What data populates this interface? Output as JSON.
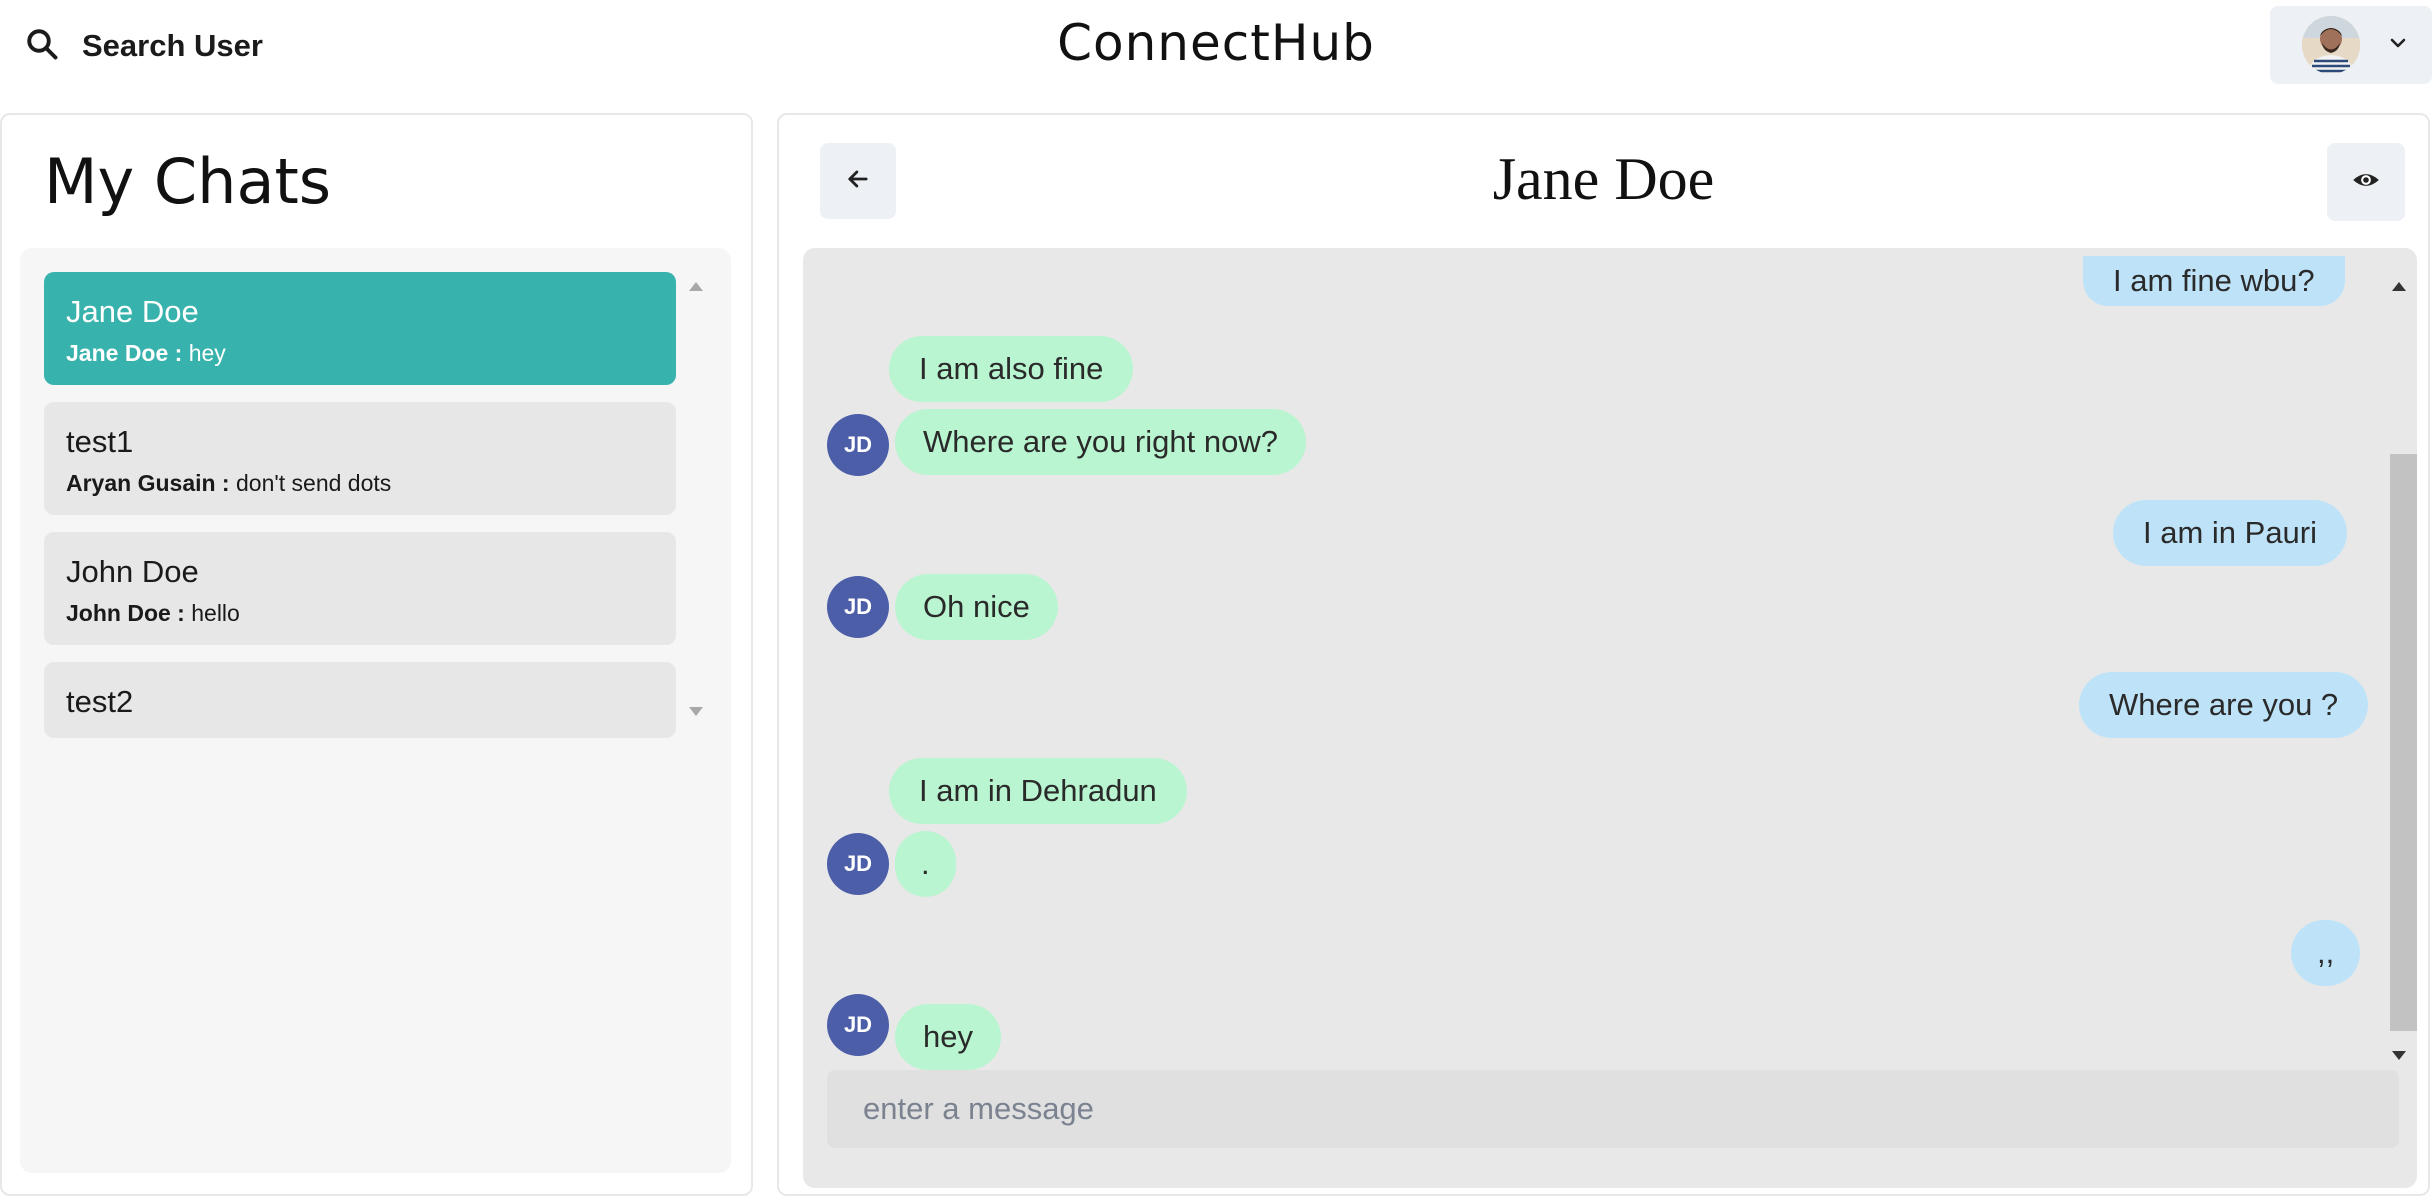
{
  "header": {
    "search_label": "Search User",
    "app_title": "ConnectHub"
  },
  "chats": {
    "title": "My Chats",
    "items": [
      {
        "name": "Jane Doe",
        "sender": "Jane Doe :",
        "message": "hey",
        "active": true
      },
      {
        "name": "test1",
        "sender": "Aryan Gusain :",
        "message": "don't send dots",
        "active": false
      },
      {
        "name": "John Doe",
        "sender": "John Doe :",
        "message": "hello",
        "active": false
      },
      {
        "name": "test2",
        "sender": "",
        "message": "",
        "active": false
      }
    ]
  },
  "conversation": {
    "title": "Jane Doe",
    "avatar_initials": "JD",
    "messages": [
      {
        "text": "I am fine wbu?",
        "from": "me"
      },
      {
        "text": "I am also fine",
        "from": "them"
      },
      {
        "text": "Where are you right now?",
        "from": "them"
      },
      {
        "text": "I am in Pauri",
        "from": "me"
      },
      {
        "text": "Oh nice",
        "from": "them"
      },
      {
        "text": "Where are you ?",
        "from": "me"
      },
      {
        "text": "I am in Dehradun",
        "from": "them"
      },
      {
        "text": ".",
        "from": "them"
      },
      {
        "text": ",,",
        "from": "me"
      },
      {
        "text": "hey",
        "from": "them"
      }
    ],
    "input_placeholder": "enter a message"
  },
  "icons": {
    "search": "search-icon",
    "chevron": "chevron-down-icon",
    "back": "arrow-left-icon",
    "view": "eye-icon"
  },
  "colors": {
    "active_chat": "#38b2ac",
    "incoming_bubble": "#b9f5d0",
    "outgoing_bubble": "#bee3f8",
    "avatar": "#4c5ea8"
  }
}
